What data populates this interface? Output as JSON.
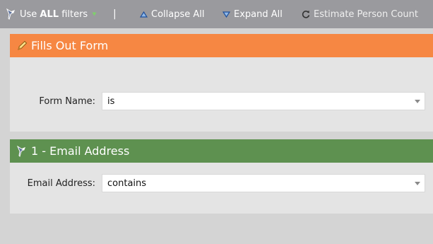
{
  "toolbar": {
    "use_all_prefix": "Use ",
    "use_all_bold": "ALL",
    "use_all_suffix": " filters",
    "separator": "|",
    "collapse_all": "Collapse All",
    "expand_all": "Expand All",
    "estimate": "Estimate Person Count"
  },
  "panels": [
    {
      "title": "Fills Out Form",
      "icon": "pencil-icon",
      "header_color": "#f68743",
      "field": {
        "label": "Form Name:",
        "value": "is"
      }
    },
    {
      "title": "1 - Email Address",
      "icon": "filter-icon",
      "header_color": "#5e9150",
      "field": {
        "label": "Email Address:",
        "value": "contains"
      }
    }
  ],
  "colors": {
    "toolbar_bg": "#9a9a9e",
    "panel_bg": "#e4e4e4",
    "page_bg": "#d4d4d4"
  }
}
